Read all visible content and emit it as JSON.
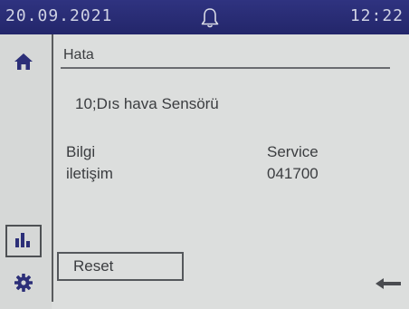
{
  "header": {
    "date": "20.09.2021",
    "time": "12:22",
    "bell_icon": "bell-icon"
  },
  "nav": {
    "home_icon": "home-icon",
    "stats_icon": "bar-chart-icon",
    "settings_icon": "gear-icon"
  },
  "main": {
    "title": "Hata",
    "error": "10;Dıs hava Sensörü",
    "info_label": "Bilgi",
    "contact_label": "iletişim",
    "service_label": "Service",
    "service_value": "041700",
    "reset_label": "Reset",
    "back_icon": "arrow-left-icon"
  },
  "colors": {
    "header_bg": "#2b2f78",
    "screen_bg": "#dcdedd",
    "text": "#3b3d40"
  }
}
